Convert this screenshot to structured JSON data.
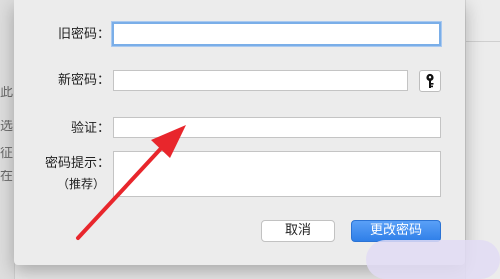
{
  "dialog": {
    "old_password_label": "旧密码：",
    "new_password_label": "新密码：",
    "verify_label": "验证：",
    "hint_label": "密码提示：",
    "hint_sublabel": "（推荐）",
    "old_password_value": "",
    "new_password_value": "",
    "verify_value": "",
    "hint_value": "",
    "key_icon": "key-icon",
    "cancel_label": "取消",
    "change_password_label": "更改密码"
  },
  "background": {
    "left_fragments": [
      "此",
      "选",
      "征",
      "在"
    ]
  },
  "annotation": {
    "arrow_color": "#e8262c",
    "icon": "red-arrow-annotation"
  },
  "colors": {
    "primary_button": "#2f7fe8",
    "focus_ring": "#7aaee8"
  }
}
